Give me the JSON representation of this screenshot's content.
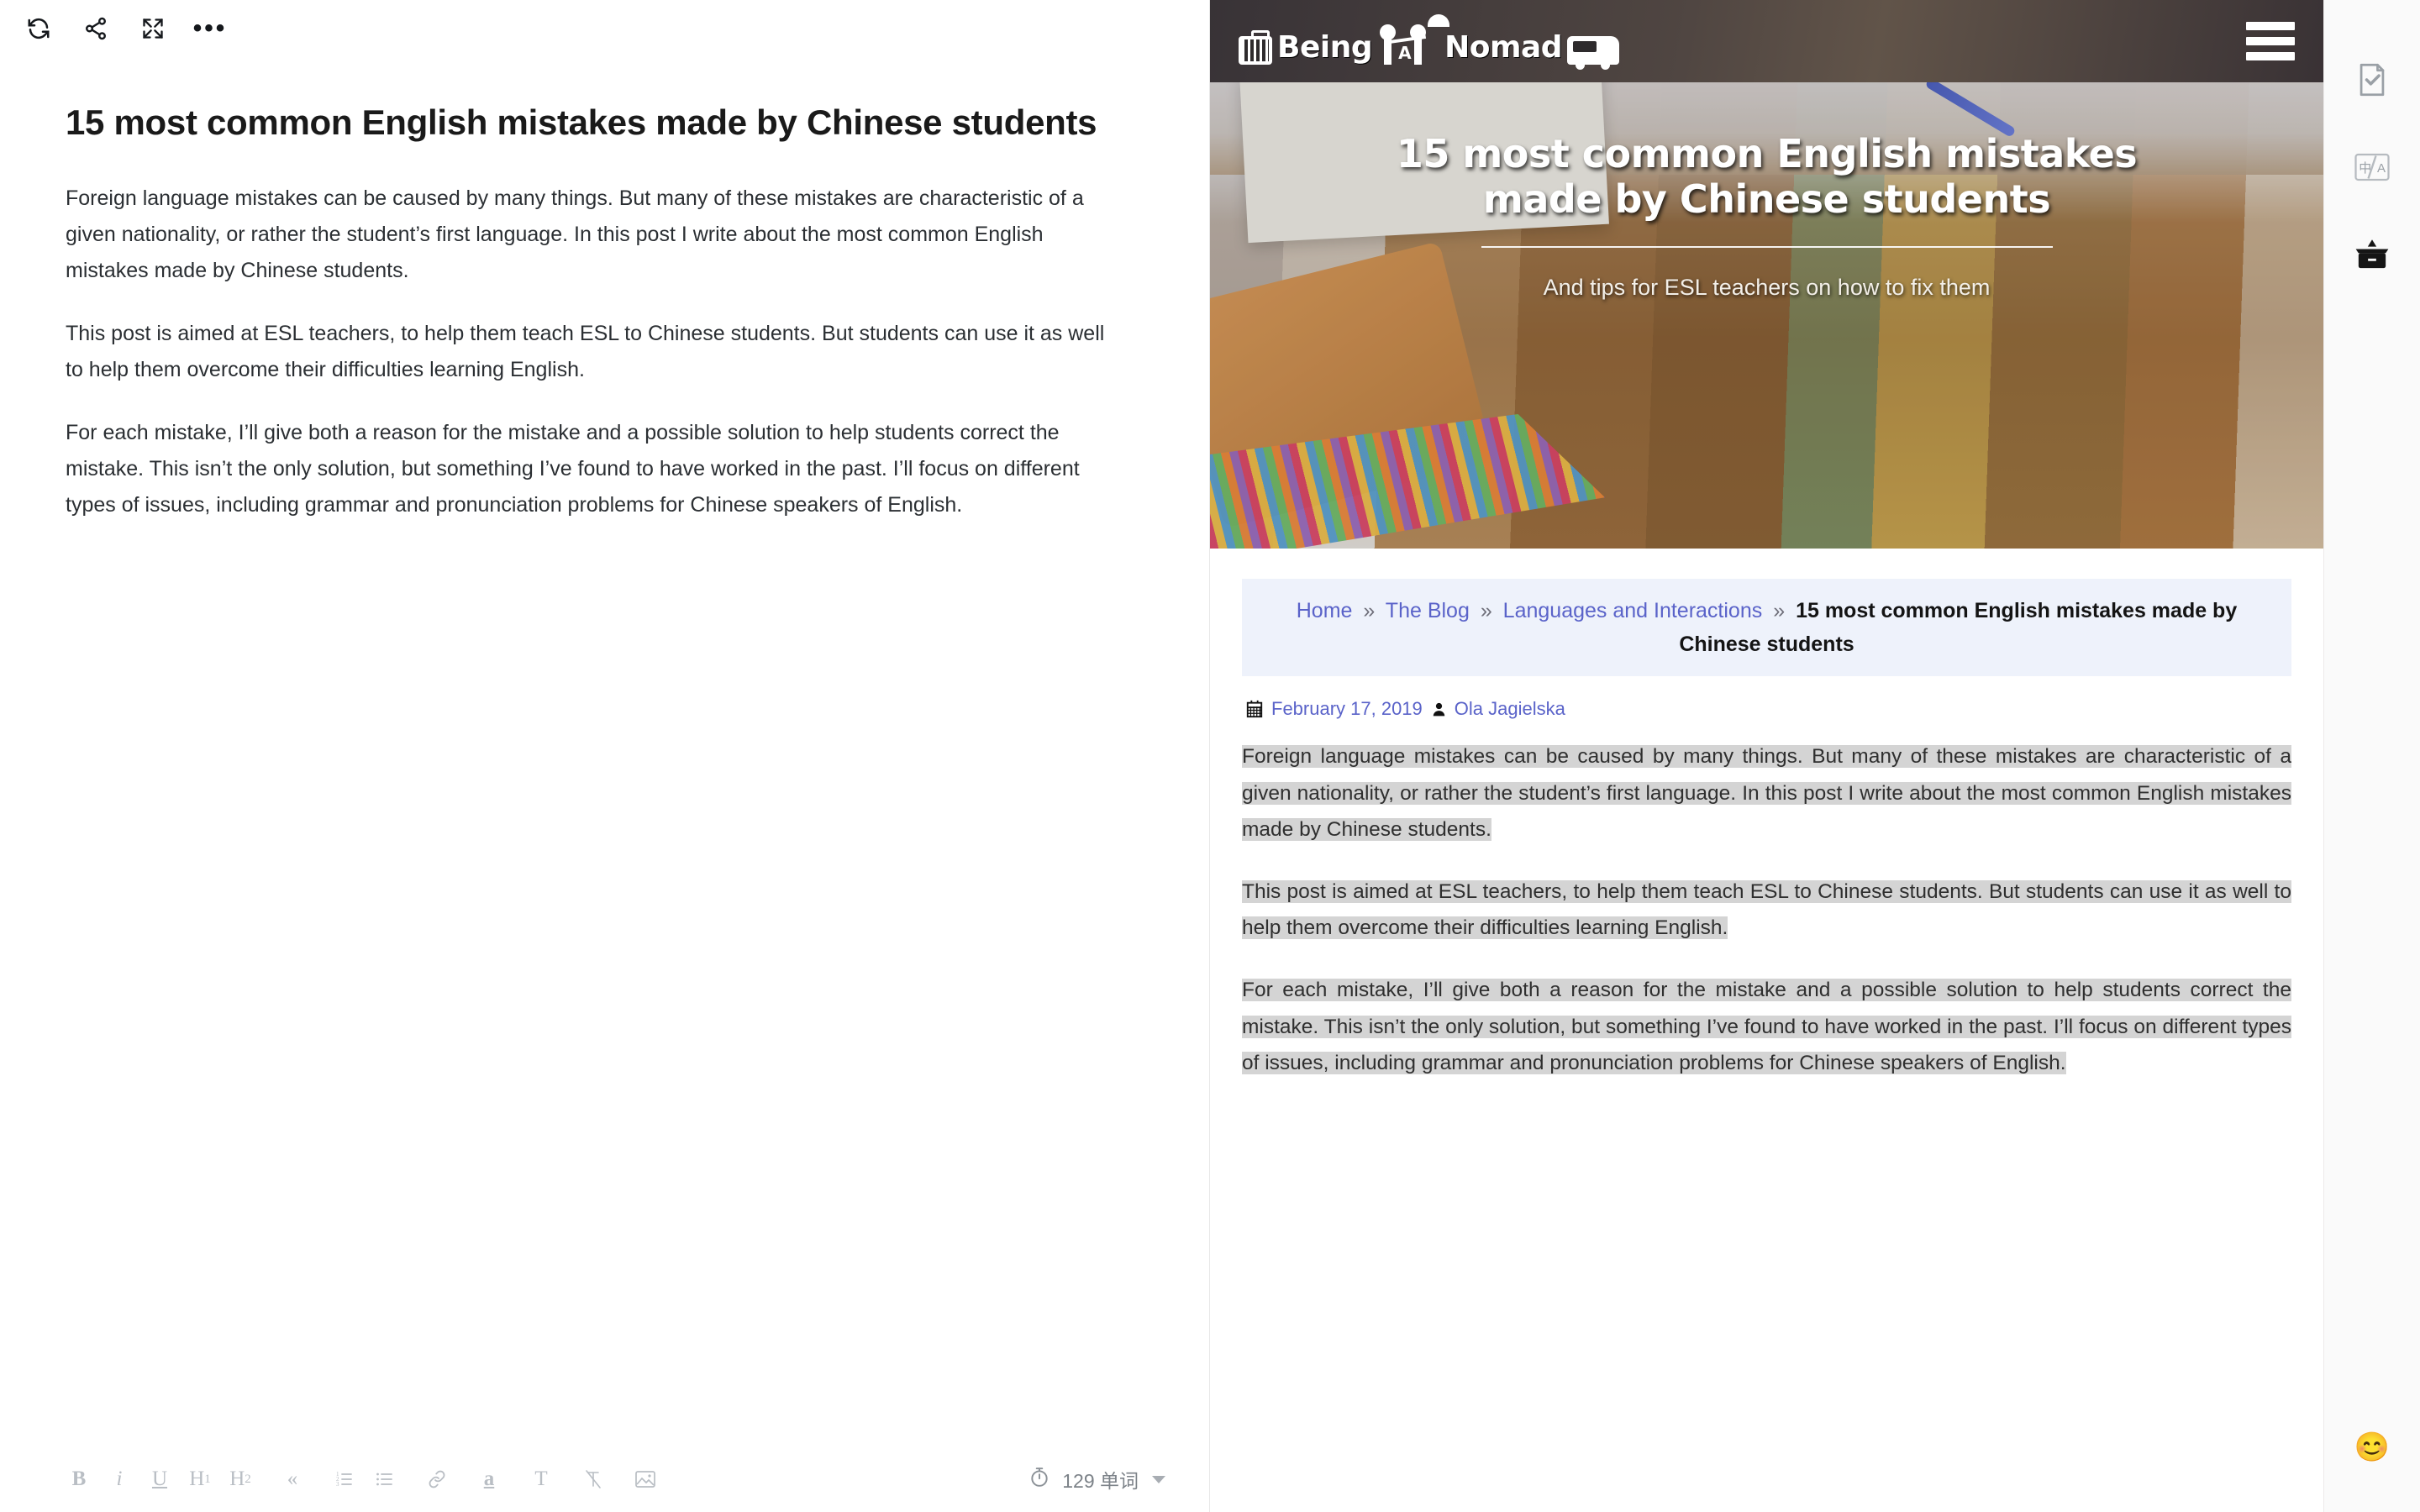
{
  "editor": {
    "toolbar_top": [
      {
        "name": "refresh-icon",
        "label": "Refresh"
      },
      {
        "name": "share-icon",
        "label": "Share"
      },
      {
        "name": "fullscreen-icon",
        "label": "Fullscreen"
      },
      {
        "name": "more-options-icon",
        "label": "More"
      }
    ],
    "title": "15 most common English mistakes made by Chinese students",
    "paragraphs": [
      "Foreign language mistakes can be caused by many things. But many of these mistakes are characteristic of a given nationality, or rather the student’s first language. In this post I write about the most common English mistakes made by Chinese students.",
      "This post is aimed at ESL teachers, to help them teach ESL to Chinese students. But students can use it as well to help them overcome their difficulties learning English.",
      "For each mistake, I’ll give both a reason for the mistake and a possible solution to help students correct the mistake. This isn’t the only solution, but something I’ve found to have worked in the past. I’ll focus on different types of issues, including grammar and pronunciation problems for Chinese speakers of English."
    ],
    "format_buttons": [
      {
        "name": "bold-button",
        "label": "B"
      },
      {
        "name": "italic-button",
        "label": "i"
      },
      {
        "name": "underline-button",
        "label": "U"
      },
      {
        "name": "heading-1-button",
        "label": "H1"
      },
      {
        "name": "heading-2-button",
        "label": "H2"
      },
      {
        "name": "blockquote-button",
        "label": "«"
      },
      {
        "name": "ordered-list-button",
        "label": "ordered-list-icon"
      },
      {
        "name": "unordered-list-button",
        "label": "unordered-list-icon"
      },
      {
        "name": "link-button",
        "label": "link-icon"
      },
      {
        "name": "highlight-button",
        "label": "a"
      },
      {
        "name": "text-style-button",
        "label": "T"
      },
      {
        "name": "clear-format-button",
        "label": "T-strike"
      },
      {
        "name": "insert-image-button",
        "label": "image-icon"
      }
    ],
    "word_count": "129 单词"
  },
  "preview": {
    "site_logo_text_1": "Being",
    "site_logo_text_2": "Nomad",
    "site_logo_letter": "A",
    "hero": {
      "title": "15 most common English mistakes made by Chinese students",
      "subtitle": "And tips for ESL teachers on how to fix them"
    },
    "breadcrumb": {
      "items": [
        {
          "label": "Home",
          "current": false
        },
        {
          "label": "The Blog",
          "current": false
        },
        {
          "label": "Languages and Interactions",
          "current": false
        },
        {
          "label": "15 most common English mistakes made by Chinese students",
          "current": true
        }
      ],
      "separator": "»"
    },
    "meta": {
      "date": "February 17, 2019",
      "author": "Ola Jagielska"
    },
    "paragraphs": [
      "Foreign language mistakes can be caused by many things. But many of these mistakes are characteristic of a given nationality, or rather the student’s first language. In this post I write about the most common English mistakes made by Chinese students.",
      "This post is aimed at ESL teachers, to help them teach ESL to Chinese students. But students can use it as well to help them overcome their difficulties learning English.",
      "For each mistake, I’ll give both a reason for the mistake and a possible solution to help students correct the mistake. This isn’t the only solution, but something I’ve found to have worked in the past. I’ll focus on different types of issues, including grammar and pronunciation problems for Chinese speakers of English."
    ]
  },
  "right_rail": {
    "items": [
      {
        "name": "document-check-icon",
        "label": "Proofread"
      },
      {
        "name": "translate-icon",
        "label": "中/A"
      },
      {
        "name": "toolbox-icon",
        "label": "Toolbox"
      }
    ],
    "emoji": "😊"
  },
  "colors": {
    "link": "#5a63c9",
    "breadcrumb_bg": "#eef2fb",
    "selection_highlight": "#d4d4d4",
    "header_bg": "#2e2b2d"
  }
}
